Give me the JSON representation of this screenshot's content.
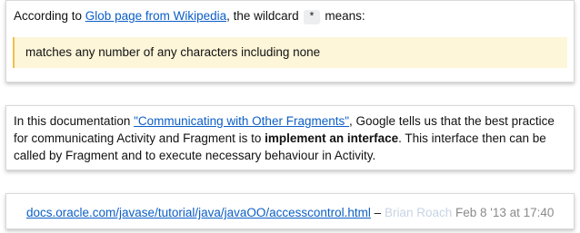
{
  "card1": {
    "prefix": "According to ",
    "link_text": "Glob page from Wikipedia",
    "middle": ", the wildcard ",
    "code": "*",
    "suffix": " means:",
    "quote": "matches any number of any characters including none"
  },
  "card2": {
    "prefix": "In this documentation ",
    "link_text": "\"Communicating with Other Fragments\"",
    "middle": ", Google tells us that the best practice for communicating Activity and Fragment is to ",
    "bold": "implement an interface",
    "suffix": ". This interface then can be called by Fragment and to execute necessary behaviour in Activity."
  },
  "card3": {
    "link_text": "docs.oracle.com/javase/tutorial/java/javaOO/accesscontrol.html",
    "dash": " – ",
    "author": "Brian Roach",
    "date": "Feb 8 '13 at 17:40"
  }
}
